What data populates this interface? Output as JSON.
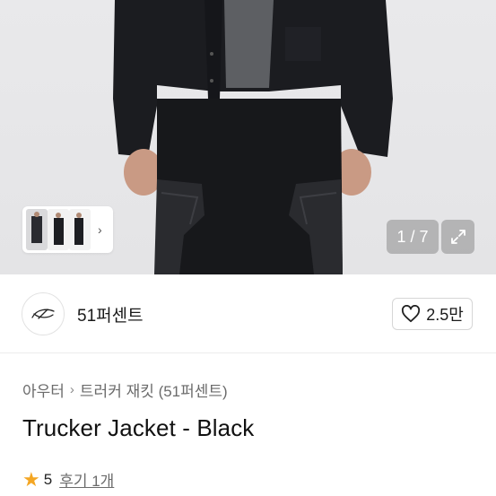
{
  "gallery": {
    "counter": "1 / 7",
    "more_chevron": "›"
  },
  "shop": {
    "name": "51퍼센트"
  },
  "like": {
    "count": "2.5만"
  },
  "breadcrumb": {
    "category": "아우터",
    "separator": "›",
    "subcategory": "트러커 재킷 (51퍼센트)"
  },
  "product": {
    "title": "Trucker Jacket - Black"
  },
  "rating": {
    "score": "5",
    "reviews_label": "후기 1개"
  },
  "colors": {
    "star": "#f4a623",
    "divider": "#ececec"
  }
}
